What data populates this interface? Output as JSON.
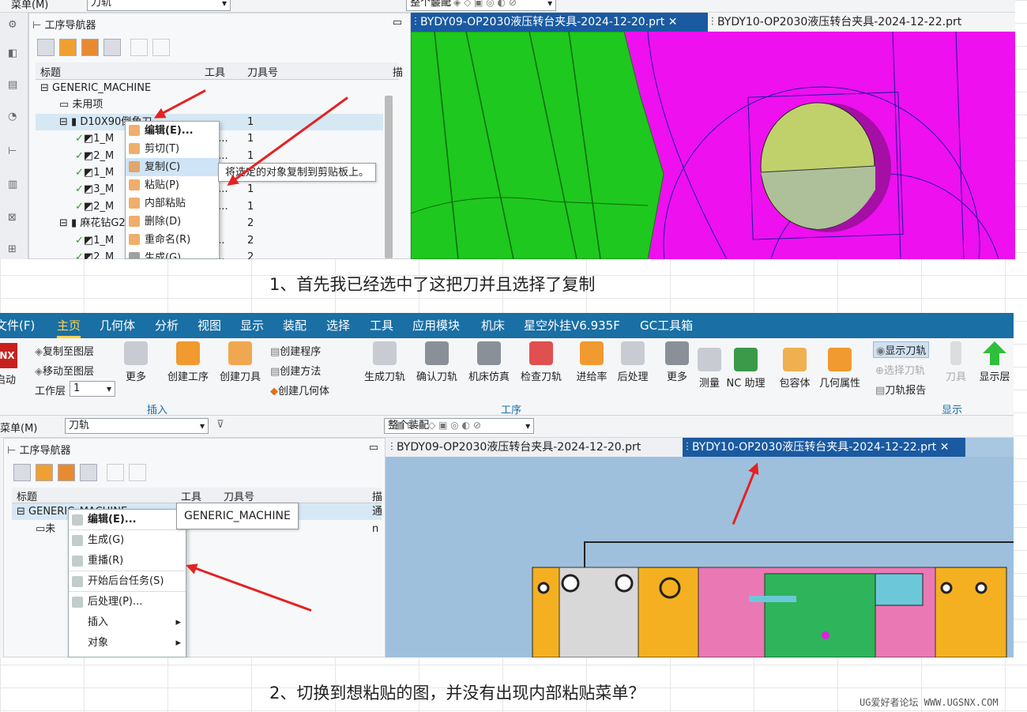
{
  "top": {
    "menu_label": "菜单(M)",
    "filter1": "刀轨",
    "filter2": "整个装配",
    "nav_title": "工序导航器",
    "col_title": "标题",
    "col_tool": "工具",
    "col_toolno": "刀具号",
    "col_extra": "描",
    "tree": [
      {
        "label": "GENERIC_MACHINE",
        "tool": "",
        "no": "",
        "indent": 0,
        "type": "root"
      },
      {
        "label": "未用项",
        "tool": "",
        "no": "",
        "indent": 1,
        "type": "folder"
      },
      {
        "label": "D10X90倒角刀",
        "tool": "",
        "no": "1",
        "indent": 1,
        "type": "tool",
        "selected": true
      },
      {
        "label": "1_M",
        "tool": "0X...",
        "no": "1",
        "indent": 2,
        "type": "op"
      },
      {
        "label": "2_M",
        "tool": "0X...",
        "no": "1",
        "indent": 2,
        "type": "op"
      },
      {
        "label": "1_M",
        "tool": "0X...",
        "no": "1",
        "indent": 2,
        "type": "op"
      },
      {
        "label": "3_M",
        "tool": "0X...",
        "no": "1",
        "indent": 2,
        "type": "op"
      },
      {
        "label": "2_M",
        "tool": "0X...",
        "no": "1",
        "indent": 2,
        "type": "op"
      },
      {
        "label": "麻花钻G2",
        "tool": "",
        "no": "2",
        "indent": 1,
        "type": "tool"
      },
      {
        "label": "1_M",
        "tool": "花...",
        "no": "2",
        "indent": 2,
        "type": "op"
      },
      {
        "label": "2_M",
        "tool": "花...",
        "no": "2",
        "indent": 2,
        "type": "op"
      }
    ],
    "context_menu": [
      "编辑(E)...",
      "剪切(T)",
      "复制(C)",
      "粘贴(P)",
      "内部粘贴",
      "删除(D)",
      "重命名(R)",
      "生成(G)"
    ],
    "tooltip": "将选定的对象复制到剪贴板上。",
    "doc_tab": "BYDY09-OP2030液压转台夹具-2024-12-20.prt",
    "doc_tab2": "BYDY10-OP2030液压转台夹具-2024-12-22.prt",
    "caption": "1、首先我已经选中了这把刀并且选择了复制"
  },
  "bottom": {
    "tabs": [
      "文件(F)",
      "主页",
      "几何体",
      "分析",
      "视图",
      "显示",
      "装配",
      "选择",
      "工具",
      "应用模块",
      "机床",
      "星空外挂V6.935F",
      "GC工具箱"
    ],
    "active_tab": "主页",
    "logo": "NX",
    "start_label": "启动",
    "layer_buttons": [
      "复制至图层",
      "移动至图层"
    ],
    "work_layer_label": "工作层",
    "work_layer_value": "1",
    "more": "更多",
    "insert_buttons": [
      "创建工序",
      "创建刀具"
    ],
    "insert_small": [
      "创建程序",
      "创建方法",
      "创建几何体"
    ],
    "group_insert": "插入",
    "op_buttons": [
      "生成刀轨",
      "确认刀轨",
      "机床仿真",
      "检查刀轨",
      "进给率",
      "后处理",
      "更多"
    ],
    "group_op": "工序",
    "util_buttons": [
      "测量",
      "NC 助理",
      "包容体",
      "几何属性"
    ],
    "display_small": [
      "显示刀轨",
      "选择刀轨",
      "刀轨报告"
    ],
    "tool_label": "刀具",
    "display_layer": "显示层",
    "group_display": "显示",
    "menu_label": "菜单(M)",
    "filter1": "刀轨",
    "filter2": "整个装配",
    "nav_title": "工序导航器",
    "col_title": "标题",
    "col_tool": "工具",
    "col_toolno": "刀具号",
    "col_extra": "描",
    "tree_root": "GENERIC_MACHINE",
    "tree_child": "未",
    "extra1": "通",
    "extra2": "n",
    "context_menu": [
      "编辑(E)...",
      "生成(G)",
      "重播(R)",
      "开始后台任务(S)",
      "后处理(P)...",
      "插入",
      "对象"
    ],
    "tooltip": "GENERIC_MACHINE",
    "doc_tab1": "BYDY09-OP2030液压转台夹具-2024-12-20.prt",
    "doc_tab2": "BYDY10-OP2030液压转台夹具-2024-12-22.prt",
    "caption": "2、切换到想粘贴的图，并没有出现内部粘贴菜单？"
  },
  "watermark": "UG爱好者论坛 WWW.UGSNX.COM",
  "colors": {
    "ribbon": "#1a6fa4",
    "accent": "#e32222",
    "green": "#1fc11f",
    "magenta": "#ee10ee"
  }
}
